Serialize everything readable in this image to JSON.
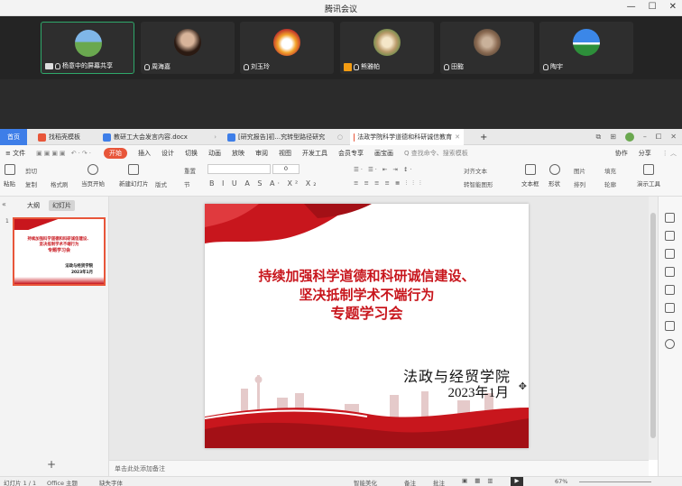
{
  "meeting": {
    "title": "腾讯会议",
    "window_controls": [
      "—",
      "☐",
      "✕"
    ],
    "participants": [
      {
        "name": "杨意中的屏幕共享",
        "active": true,
        "shared": true
      },
      {
        "name": "周海嘉"
      },
      {
        "name": "刘玉玲"
      },
      {
        "name": "熊雅帕",
        "host": true
      },
      {
        "name": "田懿"
      },
      {
        "name": "陶宇"
      }
    ]
  },
  "wps": {
    "tabs": [
      {
        "label": "首页",
        "type": "home"
      },
      {
        "label": "找稻壳模板",
        "icon_color": "#e8563a"
      },
      {
        "label": "教研工大会发言内容.docx",
        "icon_color": "#3e7ee8"
      },
      {
        "label": "[研究报告]初...究转型路径研究",
        "icon_color": "#3e7ee8"
      },
      {
        "label": "法政学院科学道德和科研诚信教育",
        "icon_color": "#e8563a",
        "current": true
      }
    ],
    "add_tab": "+",
    "menu": [
      "≡ 文件",
      "开始",
      "插入",
      "设计",
      "切换",
      "动画",
      "放映",
      "审阅",
      "视图",
      "开发工具",
      "会员专享",
      "画宝画"
    ],
    "search_placeholder": "Q 查找命令、搜索模板",
    "menu_right": [
      "协作",
      "分享"
    ],
    "ribbon": {
      "paste": "粘贴",
      "cut": "剪切",
      "copy": "复制",
      "format_painter": "格式刷",
      "from_current": "当页开始",
      "new_slide": "新建幻灯片",
      "layout": "版式",
      "section": "节",
      "reset": "重置",
      "font_size": "0",
      "para_align": "对齐文本",
      "smartart": "转智能图形",
      "textbox": "文本框",
      "shape": "形状",
      "picture": "图片",
      "arrange": "排列",
      "fill": "填充",
      "outline": "轮廓",
      "tools": "演示工具"
    },
    "left_tabs": [
      "大纲",
      "幻灯片"
    ],
    "slide_number": "1",
    "slide": {
      "title_line1": "持续加强科学道德和科研诚信建设、",
      "title_line2": "坚决抵制学术不端行为",
      "title_line3": "专题学习会",
      "org": "法政与经贸学院",
      "date": "2023年1月"
    },
    "add_slide": "+",
    "notes_placeholder": "单击此处添加备注",
    "status": {
      "slide_info": "幻灯片 1 / 1",
      "theme": "Office 主题",
      "font_missing": "缺失字体",
      "beautify": "智能美化",
      "notes": "备注",
      "comments": "批注",
      "zoom": "67%"
    },
    "colors": {
      "accent": "#e8563a",
      "home_tab": "#3e7ee8",
      "slide_red": "#c8161d"
    }
  }
}
